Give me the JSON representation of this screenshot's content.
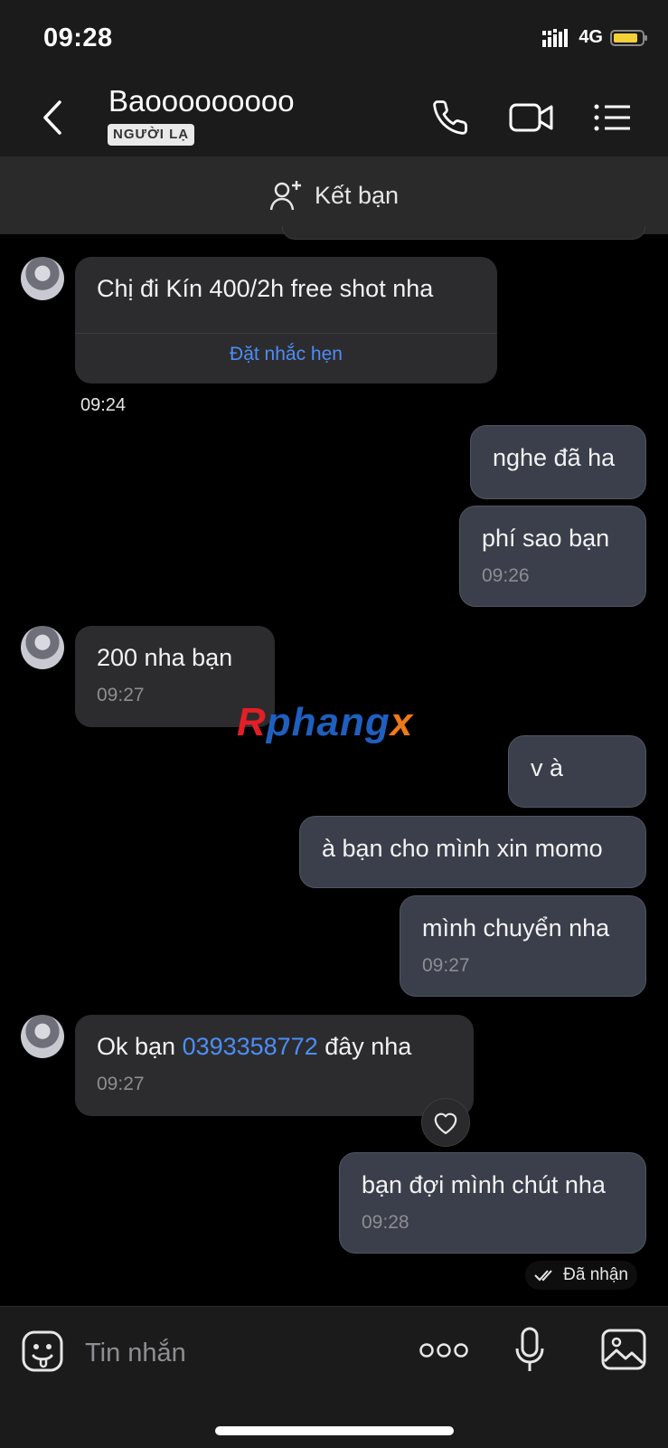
{
  "status_bar": {
    "time": "09:28",
    "network": "4G"
  },
  "header": {
    "title": "Baooooooooo",
    "badge": "NGƯỜI LẠ"
  },
  "friend_bar": {
    "label": "Kết bạn"
  },
  "messages": [
    {
      "text": "Chị đi Kín 400/2h free shot nha",
      "action": "Đặt nhắc hẹn",
      "time": "09:24"
    },
    {
      "text": "nghe đã ha"
    },
    {
      "text": "phí sao bạn",
      "time": "09:26"
    },
    {
      "text": "200 nha bạn",
      "time": "09:27"
    },
    {
      "text": "v à"
    },
    {
      "text": "à bạn cho mình xin momo"
    },
    {
      "text": "mình chuyển nha",
      "time": "09:27"
    },
    {
      "text_before": "Ok bạn ",
      "phone": "0393358772",
      "text_after": " đây nha",
      "time": "09:27"
    },
    {
      "text": "bạn đợi mình chút nha",
      "time": "09:28"
    }
  ],
  "read_status": "Đã nhận",
  "watermark": {
    "a": "R",
    "b": "phang",
    "c": "x"
  },
  "composer": {
    "placeholder": "Tin nhắn"
  },
  "colors": {
    "accent": "#4d8df5",
    "bubble_in": "#2c2c2e",
    "bubble_out": "#3a3f4b",
    "battery": "#f2d138"
  }
}
